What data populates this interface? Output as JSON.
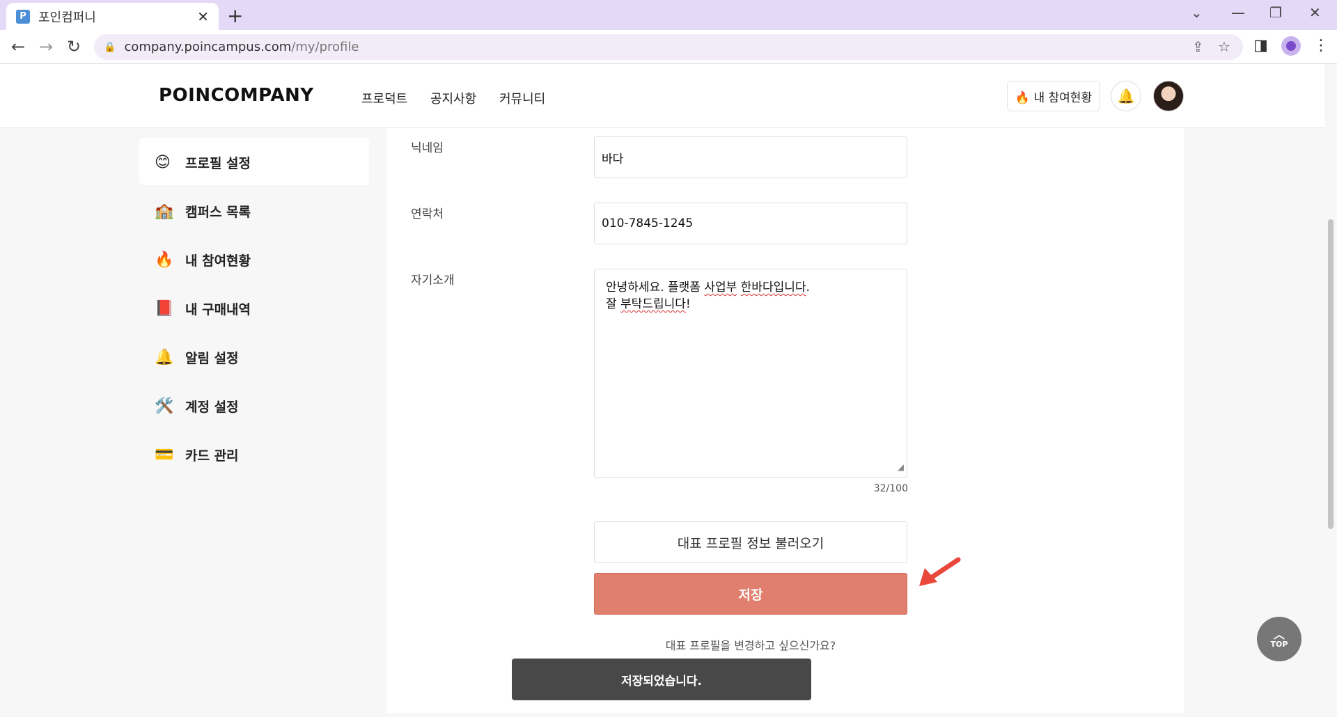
{
  "browser": {
    "tab_title": "포인컴퍼니",
    "favicon_letter": "P",
    "url_host": "company.poincampus.com",
    "url_path": "/my/profile"
  },
  "header": {
    "logo": "POINCOMPANY",
    "menu": [
      "프로덕트",
      "공지사항",
      "커뮤니티"
    ],
    "participation_button": "🔥 내 참여현황"
  },
  "sidebar": {
    "items": [
      {
        "icon": "😊",
        "label": "프로필 설정"
      },
      {
        "icon": "🏫",
        "label": "캠퍼스 목록"
      },
      {
        "icon": "🔥",
        "label": "내 참여현황"
      },
      {
        "icon": "📕",
        "label": "내 구매내역"
      },
      {
        "icon": "🔔",
        "label": "알림 설정"
      },
      {
        "icon": "🛠️",
        "label": "계정 설정"
      },
      {
        "icon": "💳",
        "label": "카드 관리"
      }
    ]
  },
  "form": {
    "nickname_label": "닉네임",
    "nickname_value": "바다",
    "phone_label": "연락처",
    "phone_value": "010-7845-1245",
    "intro_label": "자기소개",
    "intro_line1_a": "안녕하세요. 플랫폼 ",
    "intro_line1_b": "사업부",
    "intro_line1_c": " ",
    "intro_line1_d": "한바다입니다",
    "intro_line1_e": ".",
    "intro_line2_a": "잘 ",
    "intro_line2_b": "부탁드립니다",
    "intro_line2_c": "!",
    "counter": "32/100",
    "load_button": "대표 프로필 정보 불러오기",
    "save_button": "저장",
    "change_prompt": "대표 프로필을 변경하고 싶으신가요?"
  },
  "toast": "저장되었습니다.",
  "top_button": "TOP"
}
